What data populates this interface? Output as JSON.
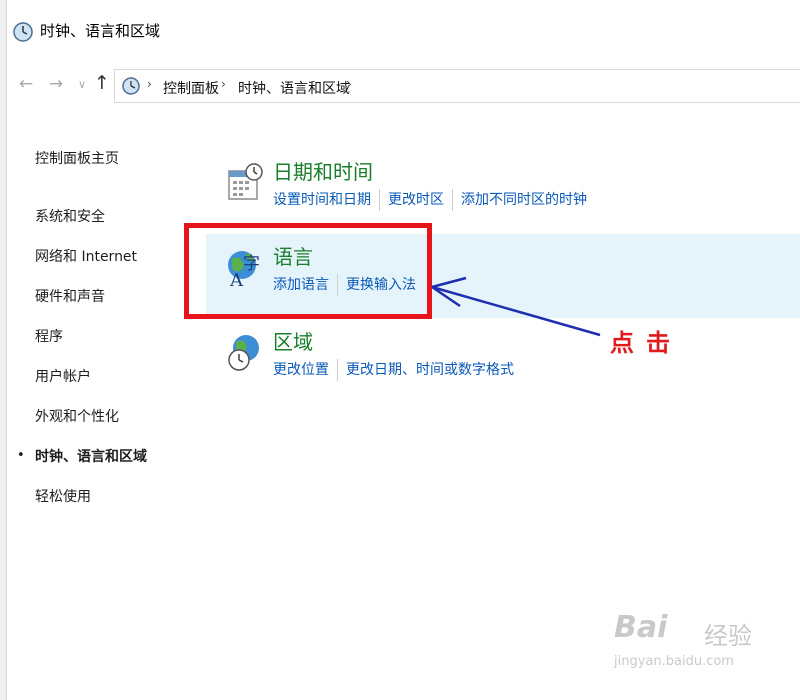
{
  "window": {
    "title": "时钟、语言和区域"
  },
  "nav": {
    "back_icon": "arrow-left-icon",
    "forward_icon": "arrow-right-icon",
    "recent_icon": "chevron-down-icon",
    "up_icon": "arrow-up-icon"
  },
  "address": {
    "separator": "›",
    "crumbs": [
      "控制面板",
      "时钟、语言和区域"
    ]
  },
  "sidebar": {
    "home": "控制面板主页",
    "items": [
      {
        "label": "系统和安全",
        "active": false
      },
      {
        "label": "网络和 Internet",
        "active": false
      },
      {
        "label": "硬件和声音",
        "active": false
      },
      {
        "label": "程序",
        "active": false
      },
      {
        "label": "用户帐户",
        "active": false
      },
      {
        "label": "外观和个性化",
        "active": false
      },
      {
        "label": "时钟、语言和区域",
        "active": true
      },
      {
        "label": "轻松使用",
        "active": false
      }
    ],
    "active_bullet": "•"
  },
  "categories": [
    {
      "title": "日期和时间",
      "icon": "calendar-clock-icon",
      "links": [
        "设置时间和日期",
        "更改时区",
        "添加不同时区的时钟"
      ]
    },
    {
      "title": "语言",
      "icon": "language-globe-icon",
      "links": [
        "添加语言",
        "更换输入法"
      ]
    },
    {
      "title": "区域",
      "icon": "region-globe-clock-icon",
      "links": [
        "更改位置",
        "更改日期、时间或数字格式"
      ]
    }
  ],
  "annotation": {
    "label": "点击",
    "highlight_color": "#e8141c",
    "arrow_color": "#1f2fb0"
  },
  "watermark": {
    "logo": "Bai",
    "logo_suffix": "经验",
    "url": "jingyan.baidu.com"
  },
  "colors": {
    "category_title": "#1a7f2a",
    "link": "#0a5ab8",
    "hover_bg": "#e5f3fb"
  }
}
